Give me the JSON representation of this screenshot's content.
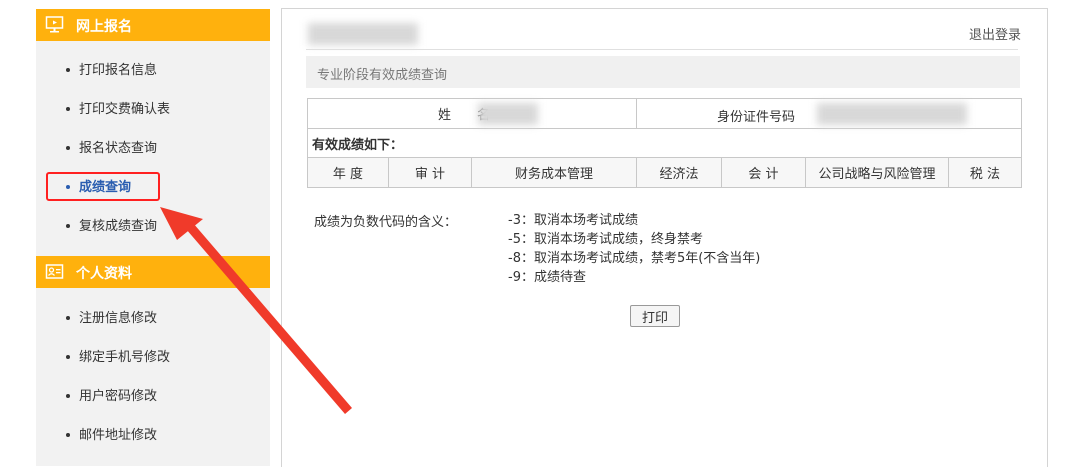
{
  "sidebar": {
    "sections": [
      {
        "title": "网上报名",
        "icon": "monitor-icon"
      },
      {
        "title": "个人资料",
        "icon": "id-card-icon"
      }
    ],
    "items": [
      {
        "label": "打印报名信息"
      },
      {
        "label": "打印交费确认表"
      },
      {
        "label": "报名状态查询"
      },
      {
        "label": "成绩查询",
        "active": true
      },
      {
        "label": "复核成绩查询"
      },
      {
        "label": "注册信息修改"
      },
      {
        "label": "绑定手机号修改"
      },
      {
        "label": "用户密码修改"
      },
      {
        "label": "邮件地址修改"
      }
    ]
  },
  "header": {
    "logout_label": "退出登录"
  },
  "main": {
    "section_title": "专业阶段有效成绩查询",
    "name_label": "姓　　名",
    "id_label": "身份证件号码",
    "valid_scores_label": "有效成绩如下：",
    "columns": [
      "年 度",
      "审 计",
      "财务成本管理",
      "经济法",
      "会 计",
      "公司战略与风险管理",
      "税 法"
    ],
    "negative_code_label": "成绩为负数代码的含义：",
    "codes": [
      "-3：取消本场考试成绩",
      "-5：取消本场考试成绩，终身禁考",
      "-8：取消本场考试成绩，禁考5年(不含当年)",
      "-9：成绩待查"
    ],
    "print_label": "打印"
  },
  "colors": {
    "accent": "#ffb10d",
    "active_link": "#2a5db0",
    "annotation": "#ff2020"
  }
}
